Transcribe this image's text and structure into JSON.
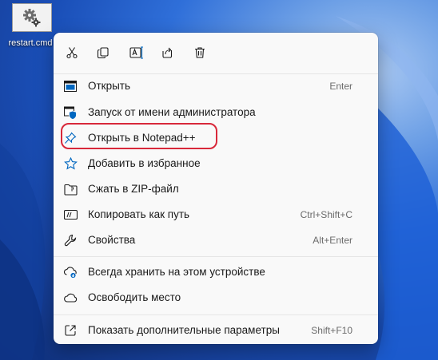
{
  "desktop": {
    "file_name": "restart.cmd",
    "file_icon": "gear-icon"
  },
  "toolbar": [
    {
      "name": "cut-icon"
    },
    {
      "name": "copy-icon"
    },
    {
      "name": "rename-icon"
    },
    {
      "name": "share-icon"
    },
    {
      "name": "delete-icon"
    }
  ],
  "menu": {
    "open": {
      "label": "Открыть",
      "shortcut": "Enter",
      "icon": "open-window-icon"
    },
    "run_as_admin": {
      "label": "Запуск от имени администратора",
      "icon": "shield-icon"
    },
    "open_notepad": {
      "label": "Открыть в Notepad++",
      "icon": "pin-icon"
    },
    "add_favorites": {
      "label": "Добавить в избранное",
      "icon": "star-icon"
    },
    "zip": {
      "label": "Сжать в ZIP-файл",
      "icon": "zip-folder-icon"
    },
    "copy_path": {
      "label": "Копировать как путь",
      "shortcut": "Ctrl+Shift+C",
      "icon": "path-icon"
    },
    "properties": {
      "label": "Свойства",
      "shortcut": "Alt+Enter",
      "icon": "wrench-icon"
    },
    "always_keep": {
      "label": "Всегда хранить на этом устройстве",
      "icon": "cloud-download-icon"
    },
    "free_space": {
      "label": "Освободить место",
      "icon": "cloud-icon"
    },
    "more_options": {
      "label": "Показать дополнительные параметры",
      "shortcut": "Shift+F10",
      "icon": "external-icon"
    }
  },
  "colors": {
    "accent": "#0067c0",
    "highlight_ring": "#d8283a",
    "menu_bg": "#f9f9f9"
  }
}
